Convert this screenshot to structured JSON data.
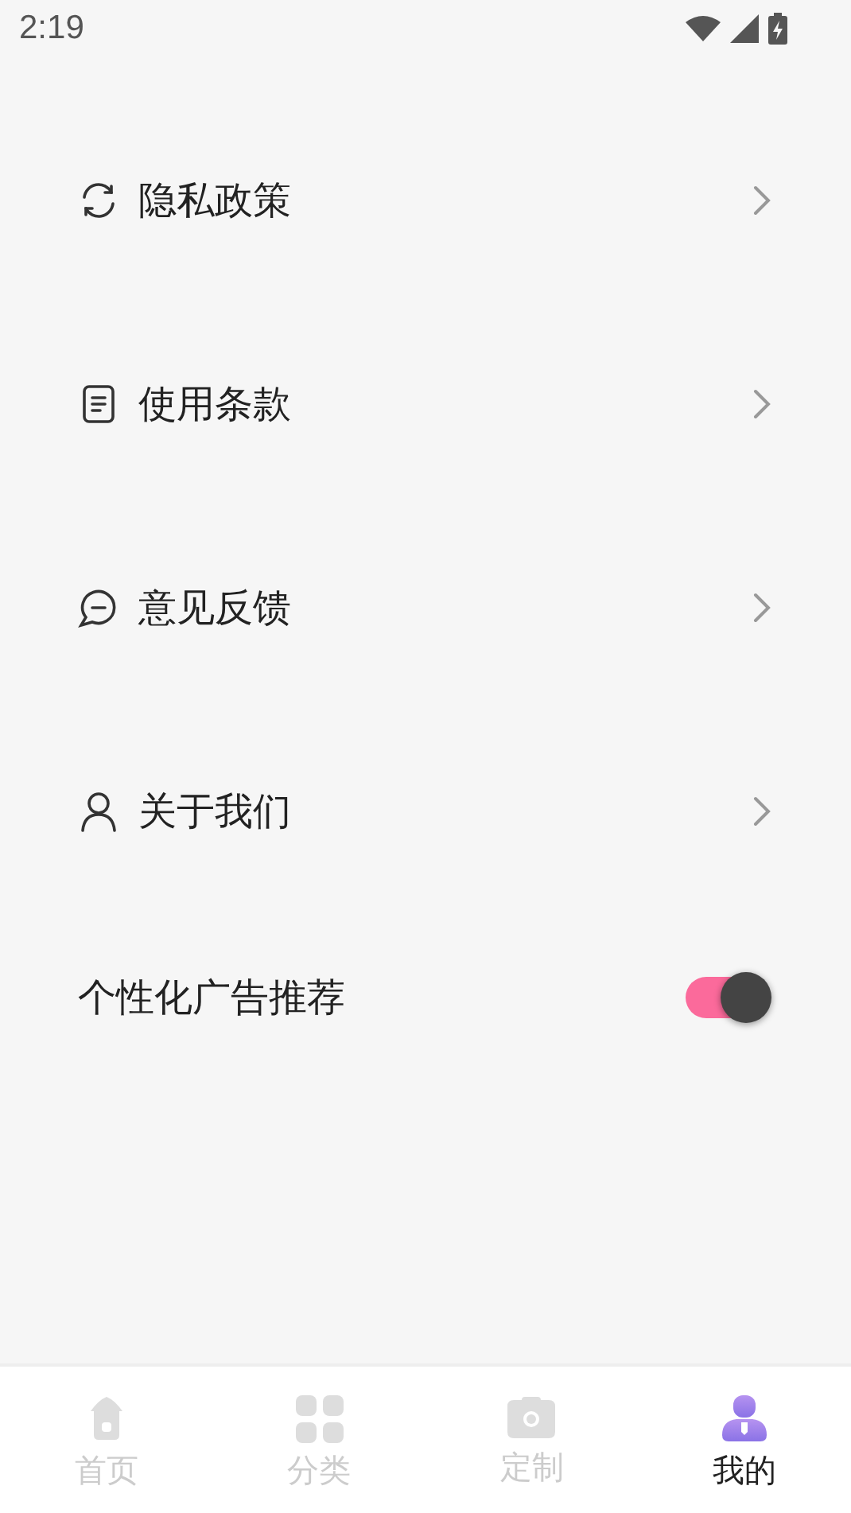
{
  "status_bar": {
    "time": "2:19"
  },
  "settings": [
    {
      "kind": "link",
      "label": "隐私政策"
    },
    {
      "kind": "link",
      "label": "使用条款"
    },
    {
      "kind": "link",
      "label": "意见反馈"
    },
    {
      "kind": "link",
      "label": "关于我们"
    },
    {
      "kind": "toggle",
      "label": "个性化广告推荐",
      "on": true
    }
  ],
  "bottom_nav": [
    {
      "label": "首页",
      "selected": false
    },
    {
      "label": "分类",
      "selected": false
    },
    {
      "label": "定制",
      "selected": false
    },
    {
      "label": "我的",
      "selected": true
    }
  ]
}
